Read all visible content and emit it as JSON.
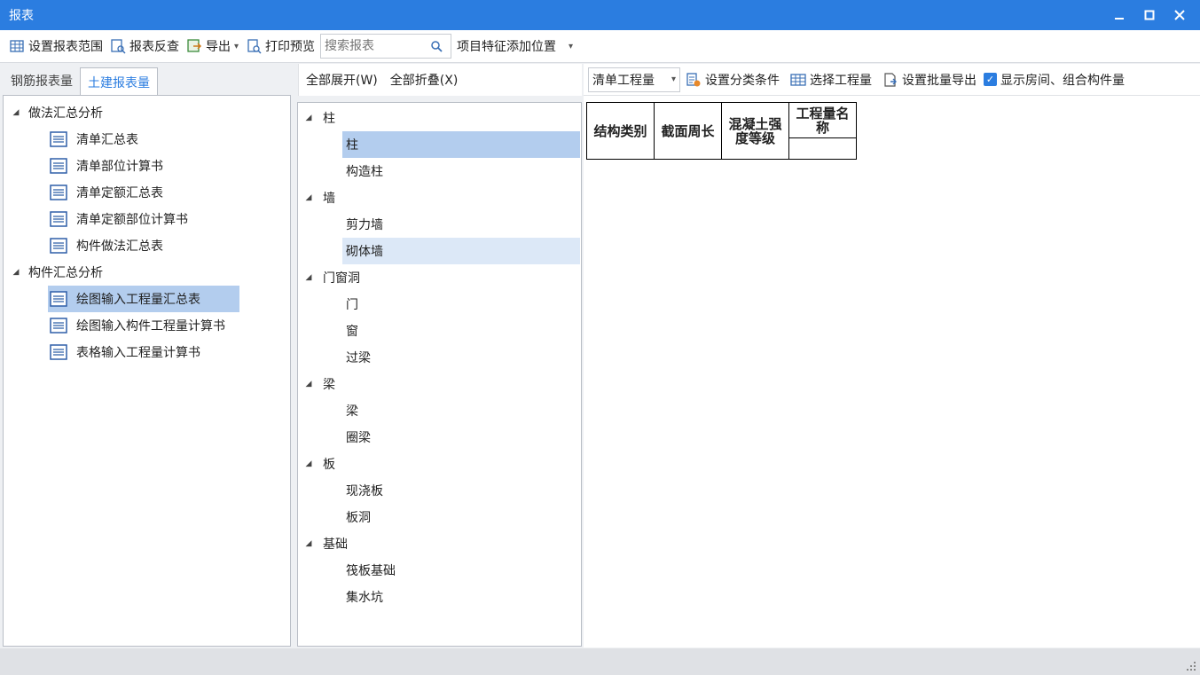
{
  "window": {
    "title": "报表",
    "minimize": "—",
    "maximize": "□",
    "close": "✕"
  },
  "toolbar": {
    "set_range": "设置报表范围",
    "reverse_check": "报表反查",
    "export": "导出",
    "print_preview": "打印预览",
    "search_placeholder": "搜索报表",
    "feature_position": "项目特征添加位置"
  },
  "tabs": [
    {
      "label": "钢筋报表量"
    },
    {
      "label": "土建报表量"
    }
  ],
  "left_tree": [
    {
      "label": "做法汇总分析",
      "level": 0,
      "children": [
        {
          "label": "清单汇总表"
        },
        {
          "label": "清单部位计算书"
        },
        {
          "label": "清单定额汇总表"
        },
        {
          "label": "清单定额部位计算书"
        },
        {
          "label": "构件做法汇总表"
        }
      ]
    },
    {
      "label": "构件汇总分析",
      "level": 0,
      "children": [
        {
          "label": "绘图输入工程量汇总表",
          "selected": true
        },
        {
          "label": "绘图输入构件工程量计算书"
        },
        {
          "label": "表格输入工程量计算书"
        }
      ]
    }
  ],
  "middle": {
    "expand_all": "全部展开(W)",
    "collapse_all": "全部折叠(X)",
    "groups": [
      {
        "label": "柱",
        "items": [
          "柱",
          "构造柱"
        ]
      },
      {
        "label": "墙",
        "items": [
          "剪力墙",
          "砌体墙"
        ]
      },
      {
        "label": "门窗洞",
        "items": [
          "门",
          "窗",
          "过梁"
        ]
      },
      {
        "label": "梁",
        "items": [
          "梁",
          "圈梁"
        ]
      },
      {
        "label": "板",
        "items": [
          "现浇板",
          "板洞"
        ]
      },
      {
        "label": "基础",
        "items": [
          "筏板基础",
          "集水坑"
        ]
      }
    ]
  },
  "right_toolbar": {
    "combo_value": "清单工程量",
    "set_classify": "设置分类条件",
    "select_quantity": "选择工程量",
    "batch_export": "设置批量导出",
    "show_rooms": "显示房间、组合构件量",
    "show_rooms_checked": true
  },
  "report_table": {
    "headers": [
      {
        "line1": "结构类别",
        "line2": ""
      },
      {
        "line1": "截面周长",
        "line2": ""
      },
      {
        "line1": "混凝土强",
        "line2": "度等级"
      },
      {
        "line1": "工程量名",
        "line2": "称"
      }
    ]
  },
  "colors": {
    "accent": "#2b7de0",
    "selected_row": "#b3cdee",
    "hover_row": "#dce8f7"
  }
}
